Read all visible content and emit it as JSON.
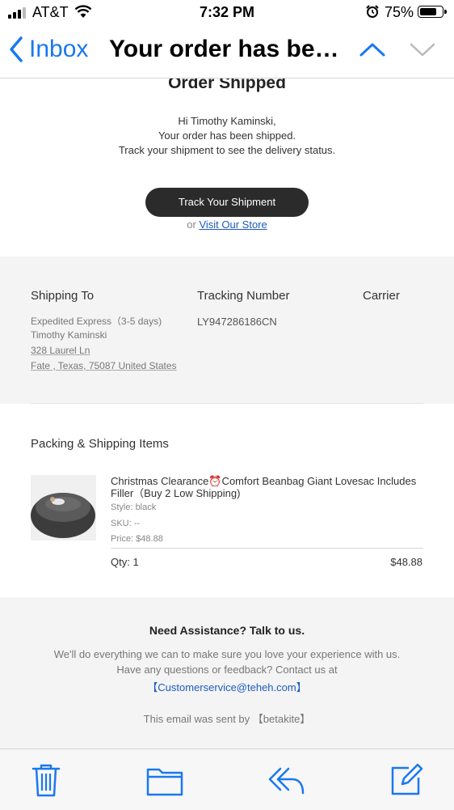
{
  "status_bar": {
    "carrier": "AT&T",
    "time": "7:32 PM",
    "battery": "75%",
    "icons": [
      "signal-icon",
      "wifi-icon",
      "alarm-icon",
      "battery-icon"
    ]
  },
  "nav": {
    "back_label": "Inbox",
    "subject": "Your order has been shipped",
    "icons": [
      "chevron-left-icon",
      "chevron-up-icon",
      "chevron-down-icon"
    ]
  },
  "email": {
    "heading": "Order Shipped",
    "greeting": "Hi Timothy Kaminski,",
    "line1": "Your order has been shipped.",
    "line2": "Track your shipment to see the delivery status.",
    "track_button": "Track Your Shipment",
    "or_text": "or",
    "store_link": "Visit Our Store",
    "shipping": {
      "shipping_to_label": "Shipping To",
      "tracking_label": "Tracking Number",
      "carrier_label": "Carrier",
      "method": "Expedited Express（3-5 days)",
      "name": "Timothy Kaminski",
      "street": "328 Laurel Ln",
      "city": "Fate , Texas, 75087 United States",
      "tracking_number": "LY947286186CN"
    },
    "items_heading": "Packing & Shipping Items",
    "item": {
      "name": "Christmas Clearance⏰Comfort Beanbag Giant Lovesac Includes Filler（Buy 2 Low Shipping)",
      "style": "Style: black",
      "sku": "SKU: --",
      "price": "Price: $48.88",
      "qty": "Qty: 1",
      "total": "$48.88"
    },
    "assistance": {
      "heading": "Need Assistance? Talk to us.",
      "line1": "We'll do everything we can to make sure you love your experience with us.",
      "line2": "Have any questions or feedback? Contact us at",
      "contact_email": "【Customerservice@teheh.com】",
      "sent_by": "This email was sent by 【betakite】"
    }
  },
  "toolbar": {
    "icons": [
      "trash-icon",
      "folder-icon",
      "reply-icon",
      "compose-icon"
    ],
    "accent": "#1a78f0"
  }
}
